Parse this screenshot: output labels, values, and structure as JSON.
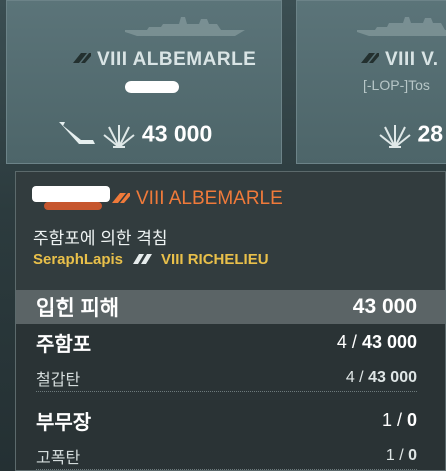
{
  "cards": [
    {
      "ship": "VIII  ALBEMARLE",
      "player": "",
      "damage": "43 000"
    },
    {
      "ship": "VIII  V.",
      "player": "[-LOP-]Tos",
      "damage": "28"
    }
  ],
  "tooltip": {
    "attacker_ship": "VIII ALBEMARLE",
    "cause": "주함포에 의한 격침",
    "victim_player": "SeraphLapis",
    "victim_ship": "VIII RICHELIEU",
    "total": {
      "label": "입힌 피해",
      "value": "43 000"
    },
    "rows": [
      {
        "label": "주함포",
        "count": "4",
        "value": "43 000",
        "kind": "category"
      },
      {
        "label": "철갑탄",
        "count": "4",
        "value": "43 000",
        "kind": "sub"
      },
      {
        "label": "부무장",
        "count": "1",
        "value": "0",
        "kind": "category"
      },
      {
        "label": "고폭탄",
        "count": "1",
        "value": "0",
        "kind": "sub"
      }
    ]
  },
  "colors": {
    "attacker": "#f07a3a",
    "victim": "#e9c04a",
    "panel": "#2a3335",
    "total_bar": "#5b6466"
  },
  "icons": [
    "ship-silhouette-icon",
    "tier-mark-icon",
    "torpedo-icon",
    "damage-burst-icon"
  ]
}
